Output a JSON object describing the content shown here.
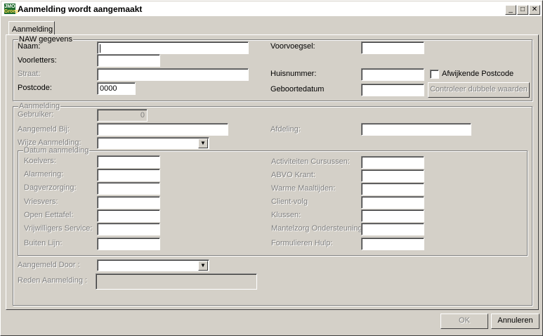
{
  "window": {
    "title": "Aanmelding wordt aangemaakt",
    "icon_top": "JMO",
    "icon_bottom": "Groep"
  },
  "tab": {
    "label": "Aanmelding"
  },
  "naw": {
    "legend": "NAW gegevens",
    "naam_label": "Naam:",
    "naam_value": "",
    "voorletters_label": "Voorletters:",
    "straat_label": "Straat:",
    "postcode_label": "Postcode:",
    "postcode_value": "0000",
    "voorvoegsel_label": "Voorvoegsel:",
    "huisnummer_label": "Huisnummer:",
    "geboortedatum_label": "Geboortedatum",
    "afwijkende_label": "Afwijkende Postcode",
    "controleer_label": "Controleer dubbele waarden"
  },
  "aanmelding": {
    "legend": "Aanmelding",
    "gebruiker_label": "Gebruiker:",
    "gebruiker_value": "0",
    "aangemeld_bij_label": "Aangemeld Bij:",
    "afdeling_label": "Afdeling:",
    "wijze_label": "Wijze Aanmelding:",
    "aangemeld_door_label": "Aangemeld Door :",
    "reden_label": "Reden Aanmelding :"
  },
  "datum": {
    "legend": "Datum aanmelding",
    "left": [
      "Koelvers:",
      "Alarmering:",
      "Dagverzorging:",
      "Vriesvers:",
      "Open Eettafel:",
      "Vrijwilligers Service:",
      "Buiten Lijn:"
    ],
    "right": [
      "Activiteiten Cursussen:",
      "ABVO Krant:",
      "Warme Maaltijden:",
      "Client-volg",
      "Klussen:",
      "Mantelzorg Ondersteuning",
      "Formulieren Hulp:"
    ]
  },
  "footer": {
    "ok_label": "OK",
    "cancel_label": "Annuleren"
  }
}
